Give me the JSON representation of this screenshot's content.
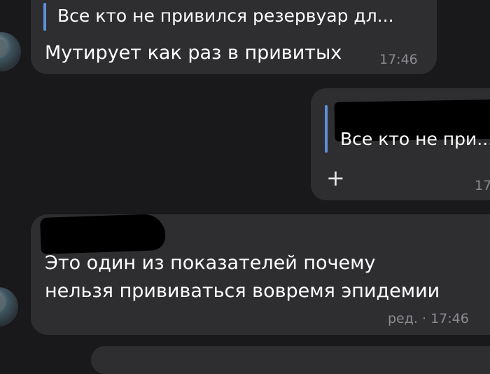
{
  "messages": [
    {
      "quote": "Все кто не привился резервуар дл...",
      "text": "Мутирует как раз в привитых",
      "time": "17:46"
    },
    {
      "quote": "Все кто не при...",
      "icon": "+",
      "time": "17"
    },
    {
      "text_line1": "Это один из показателей почему",
      "text_line2": "нельзя прививаться вовремя эпидемии",
      "time": "ред. · 17:46"
    }
  ]
}
